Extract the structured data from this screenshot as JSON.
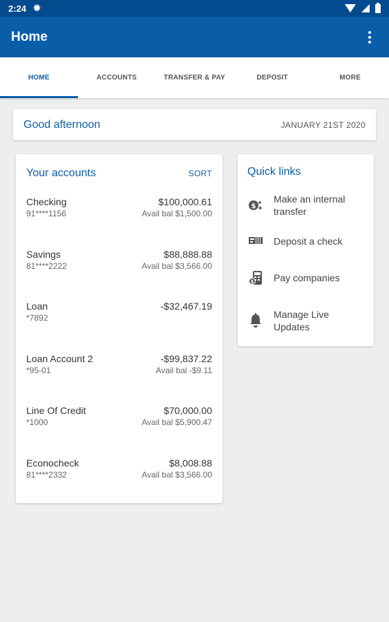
{
  "status_bar": {
    "time": "2:24"
  },
  "app_bar": {
    "title": "Home"
  },
  "tabs": [
    {
      "label": "HOME"
    },
    {
      "label": "ACCOUNTS"
    },
    {
      "label": "TRANSFER & PAY"
    },
    {
      "label": "DEPOSIT"
    },
    {
      "label": "MORE"
    }
  ],
  "greeting": {
    "text": "Good afternoon",
    "date": "JANUARY 21ST 2020"
  },
  "accounts": {
    "title": "Your accounts",
    "sort_label": "SORT",
    "items": [
      {
        "name": "Checking",
        "number": "91****1156",
        "balance": "$100,000.61",
        "avail": "Avail bal $1,500.00"
      },
      {
        "name": "Savings",
        "number": "81****2222",
        "balance": "$88,888.88",
        "avail": "Avail bal $3,566.00"
      },
      {
        "name": "Loan",
        "number": "*7892",
        "balance": "-$32,467.19",
        "avail": ""
      },
      {
        "name": "Loan Account 2",
        "number": "*95-01",
        "balance": "-$99,837.22",
        "avail": "Avail bal -$9.11"
      },
      {
        "name": "Line Of Credit",
        "number": "*1000",
        "balance": "$70,000.00",
        "avail": "Avail bal $5,900.47"
      },
      {
        "name": "Econocheck",
        "number": "81****2332",
        "balance": "$8,008.88",
        "avail": "Avail bal $3,566.00"
      }
    ]
  },
  "quick_links": {
    "title": "Quick links",
    "items": [
      {
        "label": "Make an internal transfer",
        "icon": "internal-transfer-icon"
      },
      {
        "label": "Deposit a check",
        "icon": "deposit-check-icon"
      },
      {
        "label": "Pay companies",
        "icon": "pay-companies-icon"
      },
      {
        "label": "Manage Live Updates",
        "icon": "bell-icon"
      }
    ]
  },
  "colors": {
    "status_bar": "#034a8e",
    "primary": "#0a5ea8",
    "background": "#eeeeee"
  }
}
